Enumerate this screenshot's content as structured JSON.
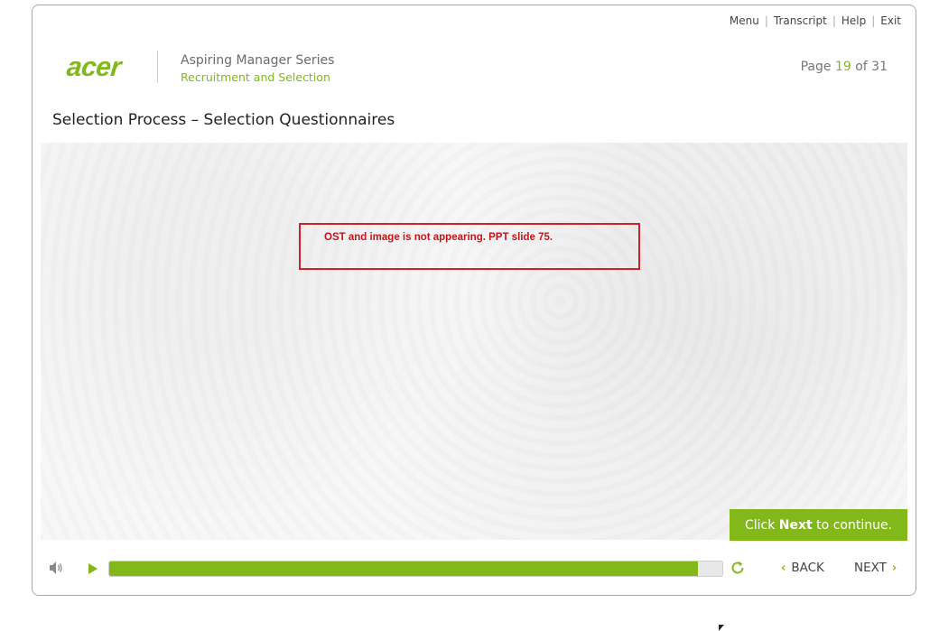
{
  "nav": {
    "menu": "Menu",
    "transcript": "Transcript",
    "help": "Help",
    "exit": "Exit",
    "separator": "|"
  },
  "logo": {
    "text": "acer"
  },
  "series": {
    "title": "Aspiring Manager Series",
    "subtitle": "Recruitment and Selection"
  },
  "page": {
    "label": "Page",
    "current": "19",
    "of": "of",
    "total": "31"
  },
  "slide": {
    "title": "Selection Process – Selection Questionnaires",
    "note": "OST and image is not appearing. PPT slide 75."
  },
  "continue": {
    "prefix": "Click ",
    "bold": "Next",
    "suffix": " to continue."
  },
  "controls": {
    "volume_icon": "speaker-icon",
    "play_icon": "play-icon",
    "replay_icon": "replay-icon",
    "progress_fraction": 0.96,
    "back_label": "BACK",
    "next_label": "NEXT"
  },
  "colors": {
    "accent": "#83b81a",
    "note_border": "#d0202a",
    "note_text": "#c4161c"
  }
}
